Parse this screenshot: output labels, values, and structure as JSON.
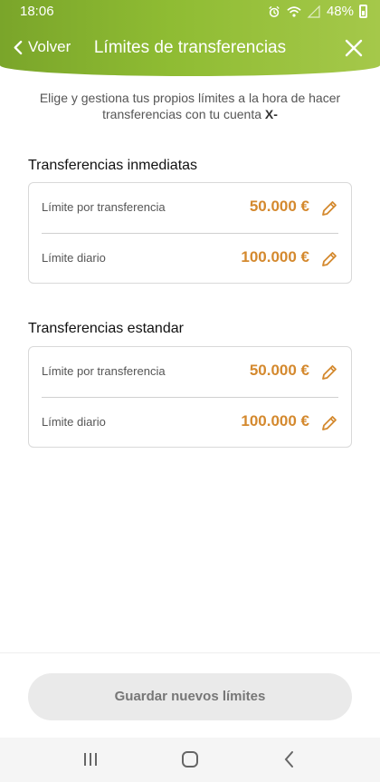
{
  "status_bar": {
    "time": "18:06",
    "battery": "48%"
  },
  "nav": {
    "back_label": "Volver",
    "title": "Límites de transferencias"
  },
  "intro": {
    "text": "Elige y gestiona tus propios límites a la hora de hacer transferencias con tu cuenta",
    "account": "X-"
  },
  "sections": [
    {
      "title": "Transferencias inmediatas",
      "rows": [
        {
          "label": "Límite por transferencia",
          "value": "50.000 €"
        },
        {
          "label": "Límite diario",
          "value": "100.000 €"
        }
      ]
    },
    {
      "title": "Transferencias estandar",
      "rows": [
        {
          "label": "Límite por transferencia",
          "value": "50.000 €"
        },
        {
          "label": "Límite diario",
          "value": "100.000 €"
        }
      ]
    }
  ],
  "save_button": {
    "label": "Guardar nuevos límites"
  },
  "colors": {
    "header_green": "#8fbc33",
    "accent_orange": "#d4892e"
  }
}
